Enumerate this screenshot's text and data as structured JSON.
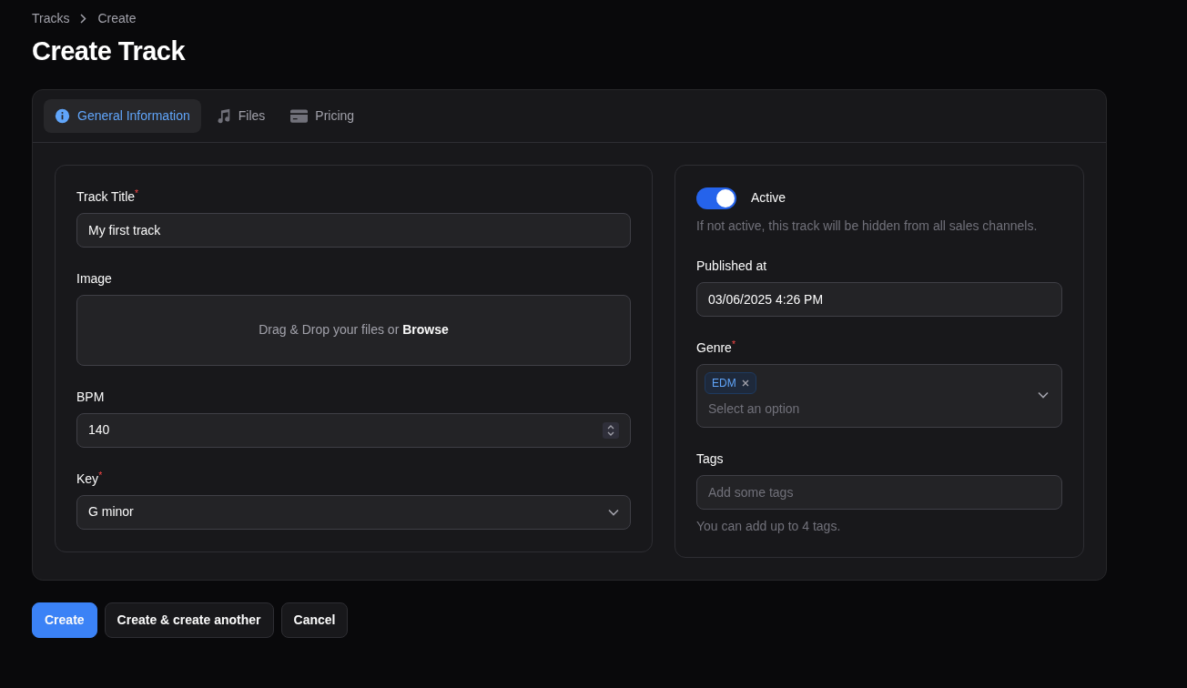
{
  "breadcrumbs": [
    {
      "label": "Tracks"
    },
    {
      "label": "Create"
    }
  ],
  "title": "Create Track",
  "tabs": [
    {
      "label": "General Information",
      "selected": true
    },
    {
      "label": "Files",
      "selected": false
    },
    {
      "label": "Pricing",
      "selected": false
    }
  ],
  "left_section": [
    {
      "kind": "text",
      "label": "Track Title$^{*}$",
      "value": "My first track"
    },
    {
      "kind": "dropzone",
      "label": "Image",
      "text": "Drag & Drop your files or **Browse**"
    },
    {
      "kind": "number",
      "label": "BPM",
      "value": "140"
    },
    {
      "kind": "select",
      "label": "Key$^{*}$",
      "value": "G minor"
    }
  ],
  "right_section": [
    {
      "kind": "toggle",
      "label": "Active",
      "on": true,
      "help": "If not active, this track will be hidden from all sales channels."
    },
    {
      "kind": "text",
      "label": "Published at",
      "value": "03/06/2025 4:26 PM"
    },
    {
      "kind": "multiselect",
      "label": "Genre$^{*}$",
      "chips": [
        "EDM"
      ],
      "placeholder": "Select an option"
    },
    {
      "kind": "text",
      "label": "Tags",
      "placeholder": "Add some tags",
      "help": "You can add up to 4 tags."
    }
  ],
  "buttons": [
    {
      "label": "Create",
      "kind": "primary"
    },
    {
      "label": "Create & create another",
      "kind": "secondary"
    },
    {
      "label": "Cancel",
      "kind": "secondary"
    }
  ]
}
